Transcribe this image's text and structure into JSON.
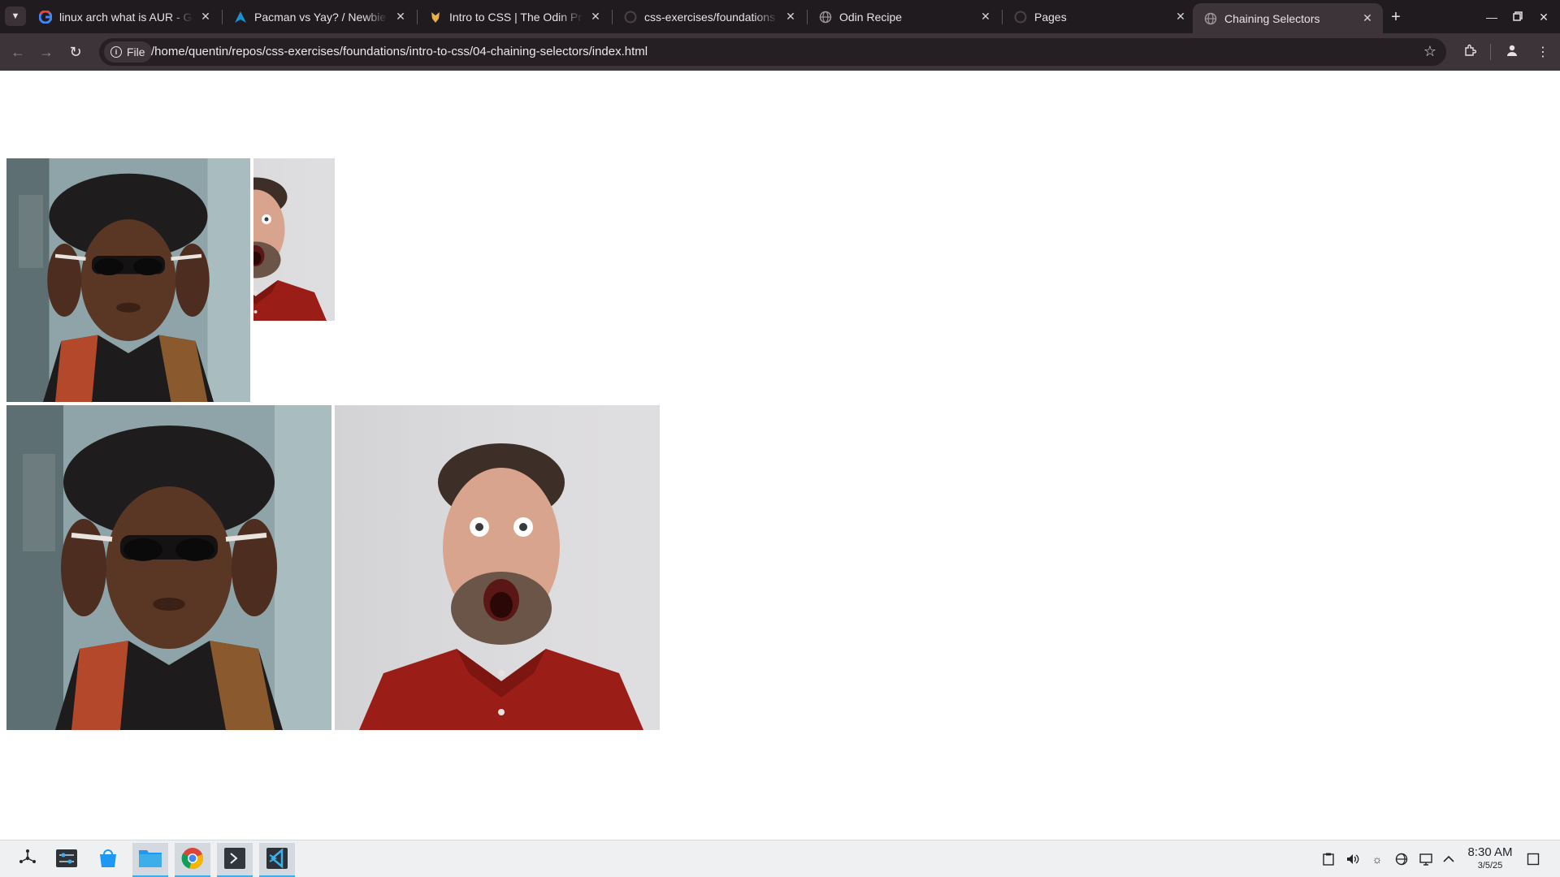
{
  "browser": {
    "tabs": [
      {
        "title": "linux arch what is AUR - Google Search",
        "favicon": "google-icon",
        "active": false
      },
      {
        "title": "Pacman vs Yay? / Newbie Corner",
        "favicon": "arch-icon",
        "active": false
      },
      {
        "title": "Intro to CSS | The Odin Project",
        "favicon": "odin-icon",
        "active": false
      },
      {
        "title": "css-exercises/foundations at main",
        "favicon": "github-icon",
        "active": false
      },
      {
        "title": "Odin Recipe",
        "favicon": "globe-icon",
        "active": false
      },
      {
        "title": "Pages",
        "favicon": "github-icon",
        "active": false
      },
      {
        "title": "Chaining Selectors",
        "favicon": "globe-icon",
        "active": true
      }
    ],
    "address_bar": {
      "scheme_chip": "File",
      "url": "/home/quentin/repos/css-exercises/foundations/intro-to-css/04-chaining-selectors/index.html"
    }
  },
  "page": {
    "images": [
      {
        "subject": "woman in beret and sunglasses"
      },
      {
        "subject": "surprised man in red shirt"
      },
      {
        "subject": "woman in beret and sunglasses"
      },
      {
        "subject": "surprised man in red shirt"
      }
    ]
  },
  "taskbar": {
    "apps": [
      {
        "name": "application-launcher-icon"
      },
      {
        "name": "system-settings-icon"
      },
      {
        "name": "discover-store-icon"
      },
      {
        "name": "file-manager-icon"
      },
      {
        "name": "chrome-icon"
      },
      {
        "name": "terminal-icon"
      },
      {
        "name": "vscode-icon"
      }
    ],
    "clock": {
      "time": "8:30 AM",
      "date": "3/5/25"
    }
  },
  "colors": {
    "tabstrip": "#1f1b1e",
    "toolbar": "#3d3439",
    "omnibox": "#251f23",
    "taskbar": "#eef0f2",
    "accent": "#3daee9"
  }
}
